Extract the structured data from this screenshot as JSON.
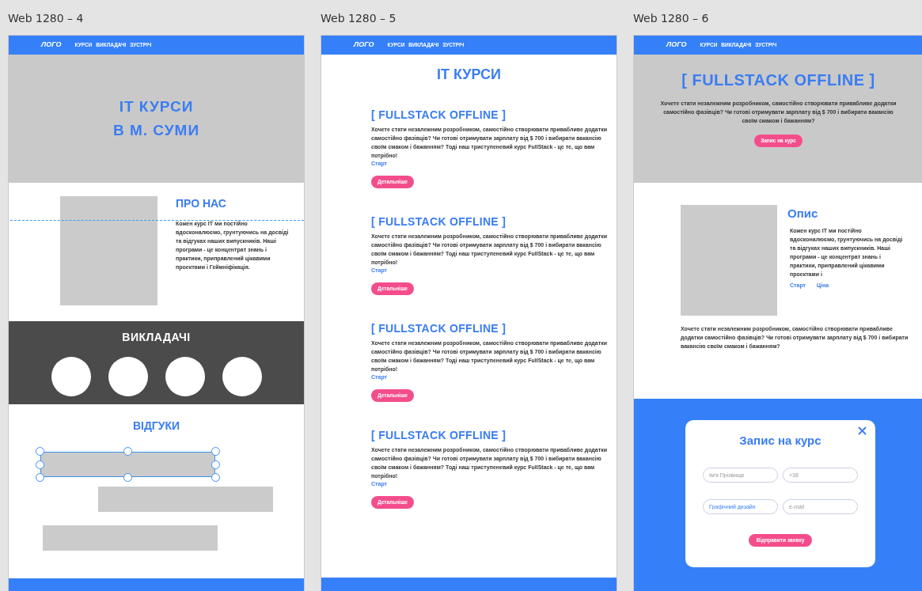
{
  "artboards": [
    {
      "title": "Web 1280 – 4",
      "nav": {
        "logo": "ЛОГО",
        "links": [
          "КУРСИ",
          "ВИКЛАДАЧІ",
          "ЗУСТРІЧ"
        ]
      },
      "sections": [
        {
          "kind": "hero",
          "lines": [
            "IT КУРСИ",
            "В М. СУМИ"
          ]
        },
        {
          "kind": "about",
          "title": "ПРО НАС",
          "text": "Кожен курс IT ми постійно вдосконалюємо, грунтуючись на досвіді та відгуках наших випускників. Наші програми - це концентрат знань і практики, приправлений цікавими проектами і Геймніфікація."
        },
        {
          "kind": "teachers",
          "title": "ВИКЛАДАЧІ",
          "avatars": [
            {
              "kind": "avatar"
            },
            {
              "kind": "avatar"
            },
            {
              "kind": "avatar"
            },
            {
              "kind": "avatar"
            }
          ]
        },
        {
          "kind": "reviews",
          "title": "ВІДГУКИ",
          "cards": [
            {
              "selected": true
            },
            {
              "selected": false
            },
            {
              "selected": false
            }
          ]
        },
        {
          "kind": "footer"
        }
      ]
    },
    {
      "title": "Web 1280 – 5",
      "nav": {
        "logo": "ЛОГО",
        "links": [
          "КУРСИ",
          "ВИКЛАДАЧІ",
          "ЗУСТРІЧ"
        ]
      },
      "sections": [
        {
          "kind": "courses",
          "title": "IT КУРСИ",
          "items": [
            {
              "title": "[ FULLSTACK OFFLINE ]",
              "text": "Хочете стати незалежним розробником, самостійно створювати привабливе додатки самостійно фазівців? Чи готові отримувати зарплату від $ 700 і вибирати вакансію своїм смаком і бажанням? Тоді наш триступеневий курс FullStack - це те, що вам потрібно!",
              "link": "Старт",
              "button": "Детальніше"
            },
            {
              "title": "[ FULLSTACK OFFLINE ]",
              "text": "Хочете стати незалежним розробником, самостійно створювати привабливе додатки самостійно фазівців? Чи готові отримувати зарплату від $ 700 і вибирати вакансію своїм смаком і бажанням? Тоді наш триступеневий курс FullStack - це те, що вам потрібно!",
              "link": "Старт",
              "button": "Детальніше"
            },
            {
              "title": "[ FULLSTACK OFFLINE ]",
              "text": "Хочете стати незалежним розробником, самостійно створювати привабливе додатки самостійно фазівців? Чи готові отримувати зарплату від $ 700 і вибирати вакансію своїм смаком і бажанням? Тоді наш триступеневий курс FullStack - це те, що вам потрібно!",
              "link": "Старт",
              "button": "Детальніше"
            },
            {
              "title": "[ FULLSTACK OFFLINE ]",
              "text": "Хочете стати незалежним розробником, самостійно створювати привабливе додатки самостійно фазівців? Чи готові отримувати зарплату від $ 700 і вибирати вакансію своїм смаком і бажанням? Тоді наш триступеневий курс FullStack - це те, що вам потрібно!",
              "link": "Старт",
              "button": "Детальніше"
            }
          ]
        },
        {
          "kind": "footer"
        }
      ]
    },
    {
      "title": "Web 1280 – 6",
      "nav": {
        "logo": "ЛОГО",
        "links": [
          "КУРСИ",
          "ВИКЛАДАЧІ",
          "ЗУСТРІЧ"
        ]
      },
      "sections": [
        {
          "kind": "course_hero",
          "title": "[ FULLSTACK OFFLINE ]",
          "text": "Хочете стати незалежним розробником, самостійно створювати привабливе додатки самостійно фазівців? Чи готові отримувати зарплату від $ 700 і вибирати вакансію своїм смаком і бажанням?",
          "button": "Запис на курс"
        },
        {
          "kind": "description",
          "title": "Опис",
          "text": "Кожен курс IT ми постійно вдосконалюємо, грунтуючись на досвіді та відгуках наших випускників. Наші програми - це концентрат знань і практики, приправлений цікавими проектами і",
          "links": [
            "Старт",
            "Ціна"
          ],
          "note": "Хочете стати незалежним розробником, самостійно створювати привабливе додатки самостійно фазівців? Чи готові отримувати зарплату від $ 700 і вибирати вакансію своїм смаком і бажанням?"
        },
        {
          "kind": "signup",
          "title": "Запис на курс",
          "fields": [
            {
              "placeholder": "Ім'я Прізвище"
            },
            {
              "placeholder": "+38"
            },
            {
              "value": "Графічний дизайн"
            },
            {
              "placeholder": "e-mail"
            }
          ],
          "button": "Відправити заявку"
        }
      ]
    }
  ]
}
